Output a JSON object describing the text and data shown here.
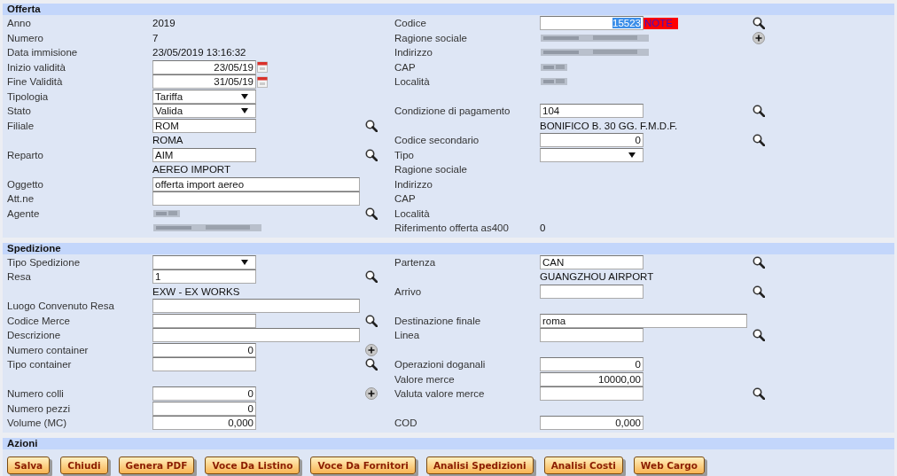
{
  "sections": [
    {
      "title": "Offerta",
      "rows": [
        {
          "left": {
            "label": "Anno",
            "kind": "text",
            "value": "2019"
          },
          "right": {
            "label": "Codice",
            "kind": "number",
            "value": "15523",
            "selected": true,
            "badge": "NOTE"
          }
        },
        {
          "left": {
            "label": "Numero",
            "kind": "text",
            "value": "7"
          },
          "right": {
            "label": "Ragione sociale",
            "kind": "redacted"
          }
        },
        {
          "left": {
            "label": "Data immisione",
            "kind": "text",
            "value": "23/05/2019 13:16:32"
          },
          "right": {
            "label": "Indirizzo",
            "kind": "redacted"
          }
        },
        {
          "left": {
            "label": "Inizio validità",
            "kind": "date",
            "value": "23/05/19"
          },
          "right": {
            "label": "CAP",
            "kind": "redacted"
          }
        },
        {
          "left": {
            "label": "Fine Validità",
            "kind": "date",
            "value": "31/05/19"
          },
          "right": {
            "label": "Località",
            "kind": "redacted"
          }
        },
        {
          "left": {
            "label": "Tipologia",
            "kind": "select",
            "value": "Tariffa"
          },
          "right": {}
        },
        {
          "left": {
            "label": "Stato",
            "kind": "select",
            "value": "Valida"
          },
          "right": {
            "label": "Condizione di pagamento",
            "kind": "input",
            "value": "104"
          }
        },
        {
          "left": {
            "label": "Filiale",
            "kind": "input",
            "value": "ROM"
          },
          "right": {
            "kind": "text",
            "value": "BONIFICO B. 30 GG. F.M.D.F."
          }
        },
        {
          "left": {
            "kind": "text",
            "value": "ROMA"
          },
          "right": {
            "label": "Codice secondario",
            "kind": "number",
            "value": "0"
          }
        },
        {
          "left": {
            "label": "Reparto",
            "kind": "input",
            "value": "AIM"
          },
          "right": {
            "label": "Tipo",
            "kind": "select"
          }
        },
        {
          "left": {
            "kind": "text",
            "value": "AEREO IMPORT"
          },
          "right": {
            "label": "Ragione sociale"
          }
        },
        {
          "left": {
            "label": "Oggetto",
            "kind": "wide",
            "value": "offerta import aereo"
          },
          "right": {
            "label": "Indirizzo"
          }
        },
        {
          "left": {
            "label": "Att.ne",
            "kind": "wide"
          },
          "right": {
            "label": "CAP"
          }
        },
        {
          "left": {
            "label": "Agente",
            "kind": "redacted"
          },
          "right": {
            "label": "Località"
          }
        },
        {
          "left": {
            "kind": "redacted"
          },
          "right": {
            "label": "Riferimento offerta as400",
            "kind": "text",
            "value": "0"
          }
        }
      ]
    },
    {
      "title": "Spedizione",
      "rows": [
        {
          "left": {
            "label": "Tipo Spedizione",
            "kind": "select"
          },
          "right": {
            "label": "Partenza",
            "kind": "input",
            "value": "CAN"
          }
        },
        {
          "left": {
            "label": "Resa",
            "kind": "input",
            "value": "1"
          },
          "right": {
            "kind": "text",
            "value": "GUANGZHOU AIRPORT"
          }
        },
        {
          "left": {
            "kind": "text",
            "value": "EXW - EX WORKS"
          },
          "right": {
            "label": "Arrivo",
            "kind": "input"
          }
        },
        {
          "left": {
            "label": "Luogo Convenuto Resa",
            "kind": "wide"
          },
          "right": {}
        },
        {
          "left": {
            "label": "Codice Merce",
            "kind": "input"
          },
          "right": {
            "label": "Destinazione finale",
            "kind": "wide",
            "value": "roma"
          }
        },
        {
          "left": {
            "label": "Descrizione",
            "kind": "wide"
          },
          "right": {
            "label": "Linea",
            "kind": "input"
          }
        },
        {
          "left": {
            "label": "Numero container",
            "kind": "number",
            "value": "0"
          },
          "right": {}
        },
        {
          "left": {
            "label": "Tipo container",
            "kind": "input"
          },
          "right": {
            "label": "Operazioni doganali",
            "kind": "number",
            "value": "0"
          }
        },
        {
          "left": {},
          "right": {
            "label": "Valore merce",
            "kind": "number",
            "value": "10000,00"
          }
        },
        {
          "left": {
            "label": "Numero colli",
            "kind": "number",
            "value": "0"
          },
          "right": {
            "label": "Valuta valore merce",
            "kind": "input"
          }
        },
        {
          "left": {
            "label": "Numero pezzi",
            "kind": "number",
            "value": "0"
          },
          "right": {}
        },
        {
          "left": {
            "label": "Volume (MC)",
            "kind": "number",
            "value": "0,000"
          },
          "right": {
            "label": "COD",
            "kind": "number",
            "value": "0,000"
          }
        }
      ]
    }
  ],
  "actions": {
    "title": "Azioni",
    "buttons": [
      "Salva",
      "Chiudi",
      "Genera PDF",
      "Voce Da Listino",
      "Voce Da Fornitori",
      "Analisi Spedizioni",
      "Analisi Costi",
      "Web Cargo"
    ]
  }
}
